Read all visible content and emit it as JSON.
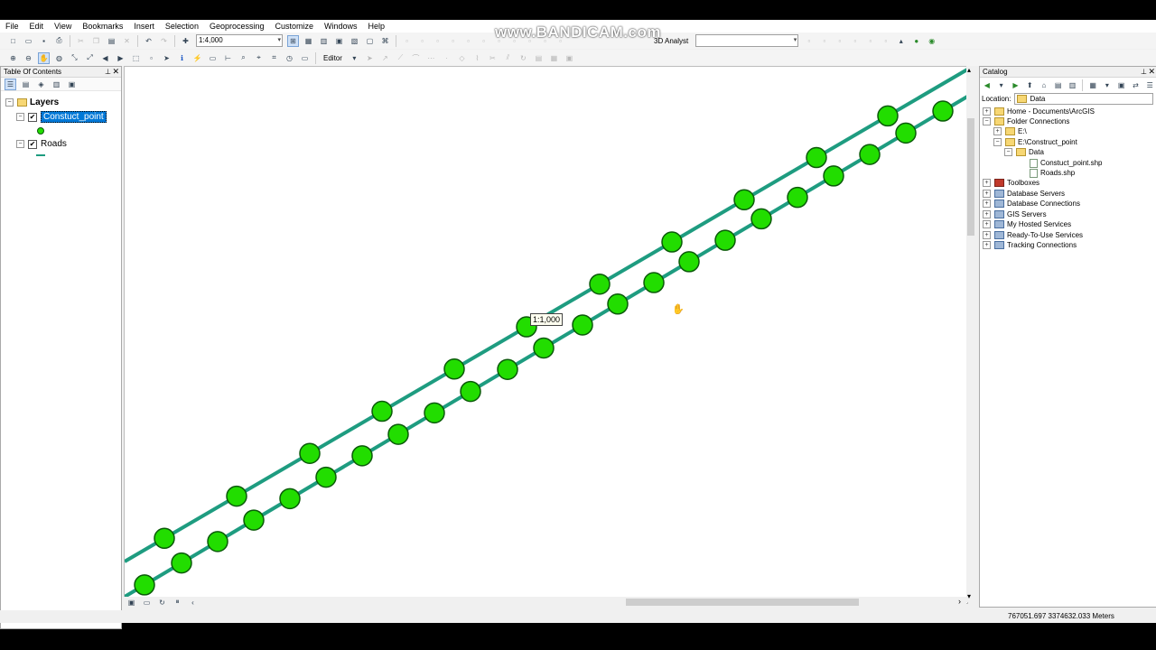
{
  "watermark": "www.BANDICAM.com",
  "menu": [
    "File",
    "Edit",
    "View",
    "Bookmarks",
    "Insert",
    "Selection",
    "Geoprocessing",
    "Customize",
    "Windows",
    "Help"
  ],
  "toolbar": {
    "scale_value": "1:4,000",
    "analyst_label": "3D Analyst",
    "editor_label": "Editor"
  },
  "toc": {
    "title": "Table Of Contents",
    "layers_label": "Layers",
    "layer1": "Constuct_point",
    "layer2": "Roads"
  },
  "map": {
    "scale_tip": "1:1,000",
    "colors": {
      "road": "#1e9c80",
      "point_fill": "#22dd00",
      "point_stroke": "#0a5a08"
    }
  },
  "catalog": {
    "title": "Catalog",
    "location_label": "Location:",
    "location_value": "Data",
    "tree": [
      "Home - Documents\\ArcGIS",
      "Folder Connections",
      "E:\\",
      "E:\\Construct_point",
      "Data",
      "Constuct_point.shp",
      "Roads.shp",
      "Toolboxes",
      "Database Servers",
      "Database Connections",
      "GIS Servers",
      "My Hosted Services",
      "Ready-To-Use Services",
      "Tracking Connections"
    ]
  },
  "status": {
    "coords": "767051.697  3374632.033 Meters"
  }
}
